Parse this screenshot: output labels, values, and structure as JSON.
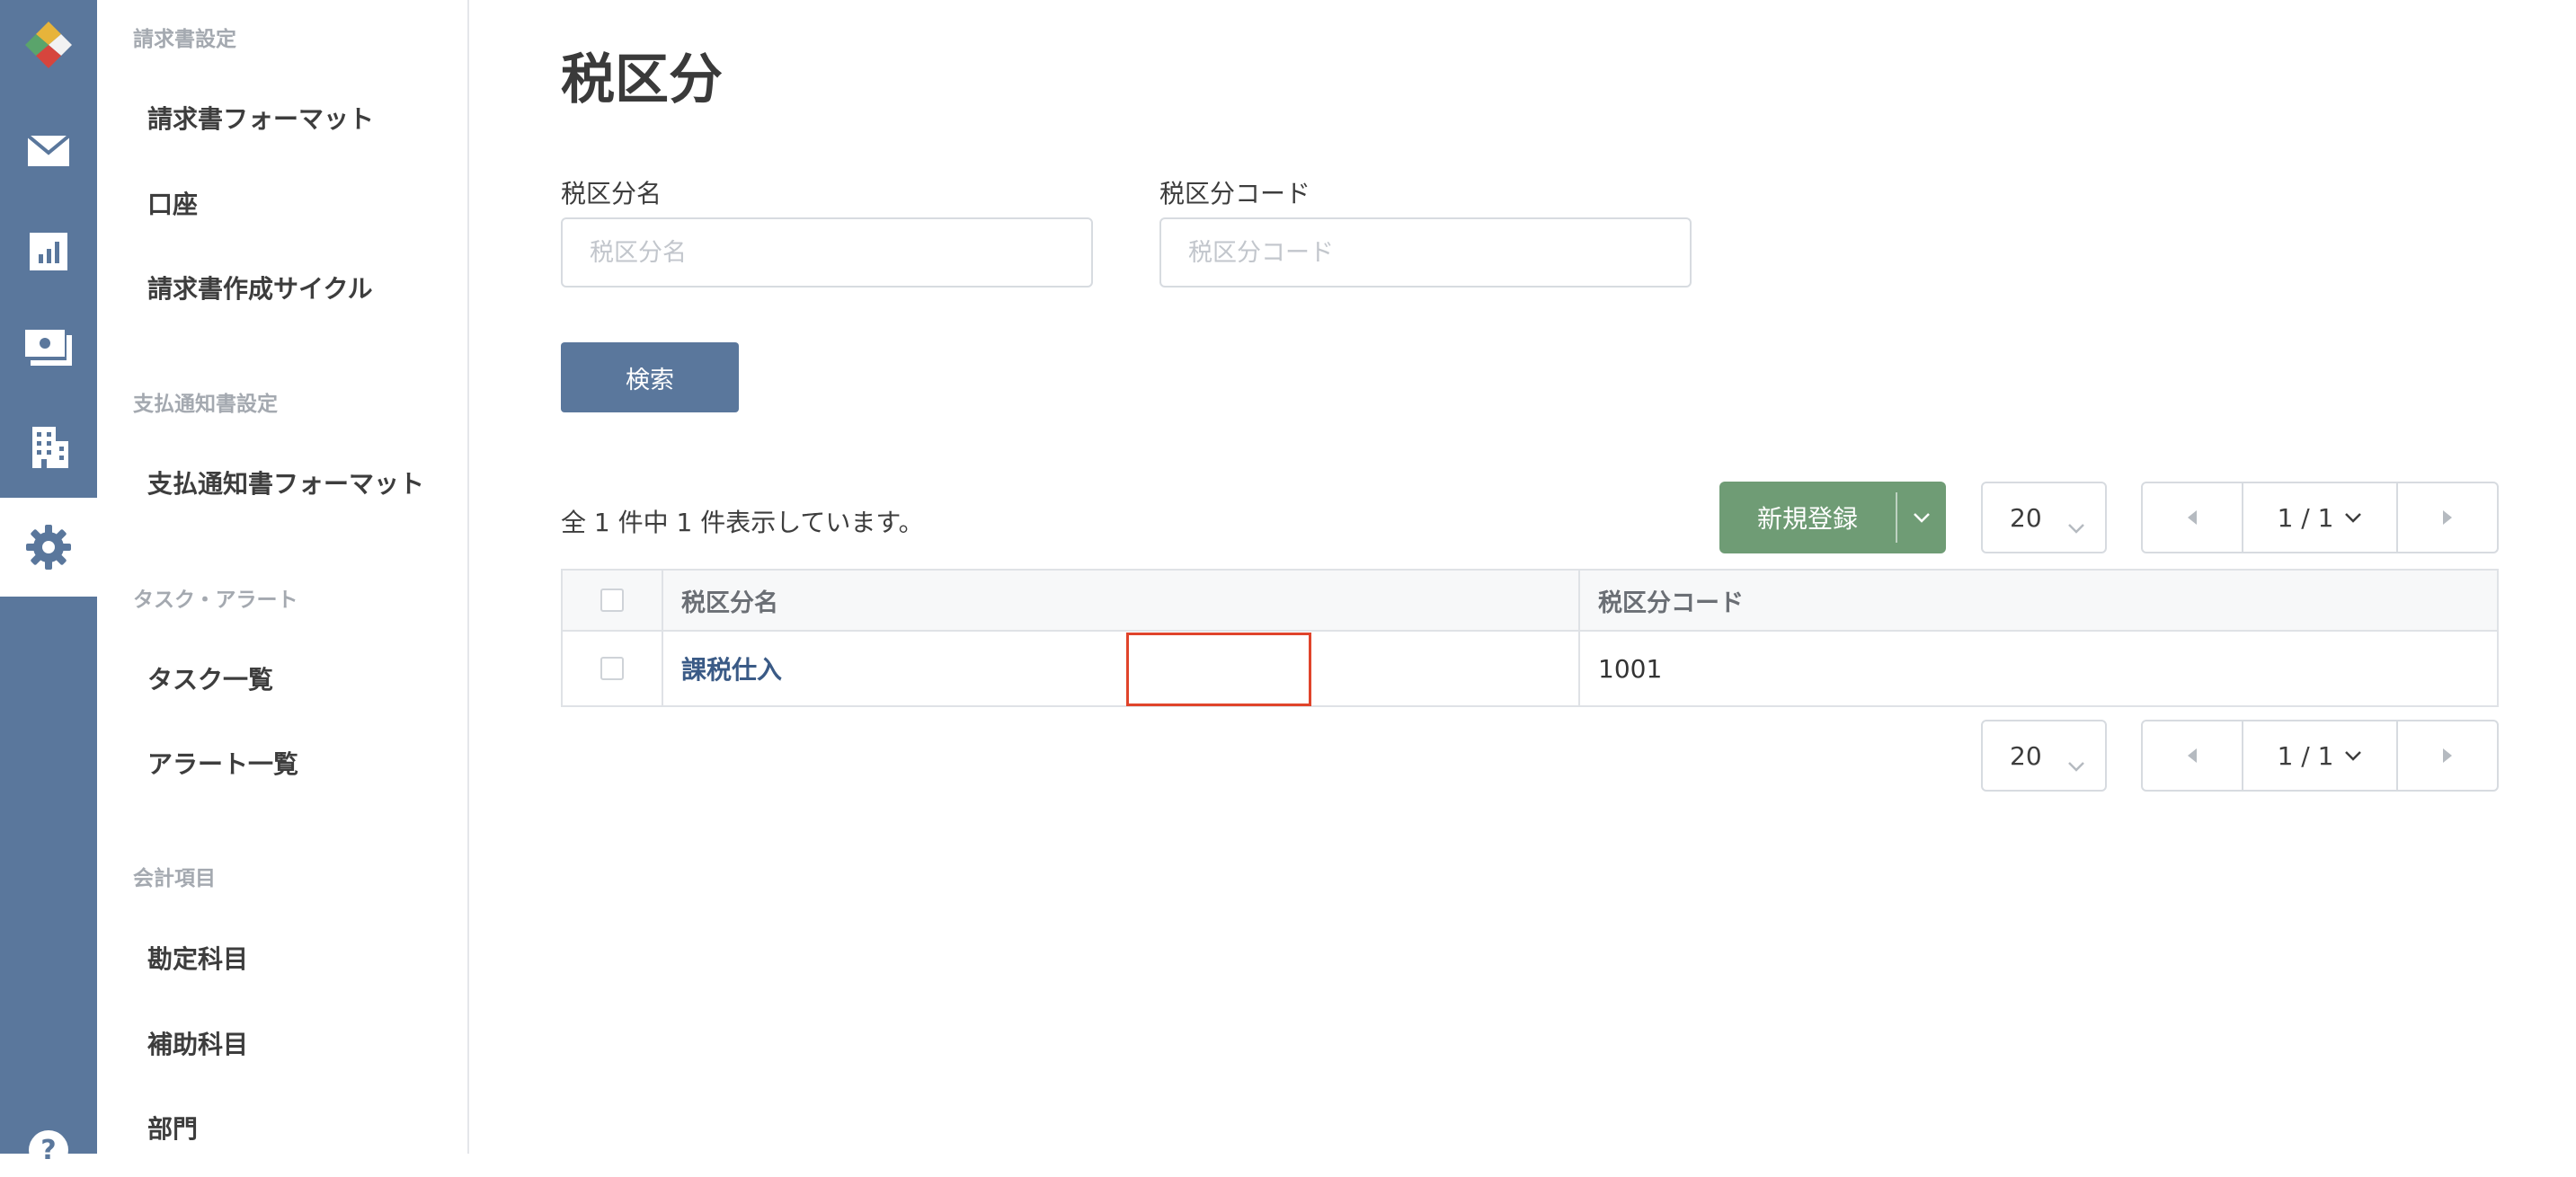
{
  "rail": {
    "icons": [
      "logo-icon",
      "mail-icon",
      "chart-icon",
      "payment-icon",
      "building-icon",
      "gear-icon",
      "help-icon"
    ],
    "active": "gear-icon",
    "bg_color": "#5a779c"
  },
  "sidebar": {
    "sections": [
      {
        "title": "請求書設定",
        "items": [
          "請求書フォーマット",
          "口座",
          "請求書作成サイクル"
        ]
      },
      {
        "title": "支払通知書設定",
        "items": [
          "支払通知書フォーマット"
        ]
      },
      {
        "title": "タスク・アラート",
        "items": [
          "タスク一覧",
          "アラート一覧"
        ]
      },
      {
        "title": "会計項目",
        "items": [
          "勘定科目",
          "補助科目",
          "部門"
        ]
      }
    ]
  },
  "main": {
    "title": "税区分",
    "filters": {
      "name_label": "税区分名",
      "name_placeholder": "税区分名",
      "code_label": "税区分コード",
      "code_placeholder": "税区分コード"
    },
    "search_label": "検索",
    "count_text": "全 1 件中 1 件表示しています。",
    "new_label": "新規登録",
    "per_page": "20",
    "page_indicator": "1 / 1",
    "table": {
      "headers": [
        "税区分名",
        "税区分コード"
      ],
      "rows": [
        {
          "name": "課税仕入",
          "code": "1001"
        }
      ]
    }
  },
  "colors": {
    "primary": "#5a779c",
    "success": "#6f9c75",
    "link": "#3a5a86",
    "highlight": "#e0442b"
  }
}
